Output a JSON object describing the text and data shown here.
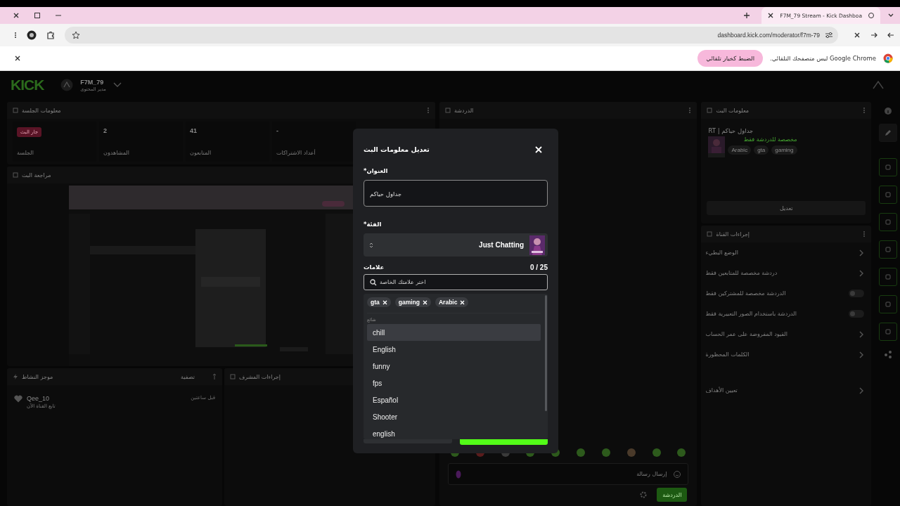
{
  "browser": {
    "tab": {
      "title": "F7M_79 Stream - Kick Dashboa",
      "selected": true
    },
    "address": "dashboard.kick.com/moderator/f7m-79",
    "infobar": {
      "message": "Google Chrome ليس متصفحك التلقائي.",
      "button": "الضبط كخيار تلقائي"
    }
  },
  "dashboard": {
    "header": {
      "logo": "KICK",
      "channel": "F7M_79",
      "role": "مدير المحتوى"
    },
    "session": {
      "title": "معلومات الجلسة",
      "stats": [
        {
          "kind": "number",
          "value": "-",
          "label": "أعداد الاشتراكات"
        },
        {
          "kind": "number",
          "value": "41",
          "label": "المتابعون"
        },
        {
          "kind": "number",
          "value": "2",
          "label": "المشاهدون"
        },
        {
          "kind": "badge",
          "value": "جار البث",
          "label": "الجلسة"
        }
      ]
    },
    "review": {
      "title": "مراجعة البث"
    },
    "activity": {
      "title": "موجز النشاط",
      "filter": "تصفية",
      "items": [
        {
          "user": "Qee_10",
          "action": "تابع القناة الآن",
          "time": "قبل ساعتين"
        }
      ]
    },
    "mod_actions": {
      "title": "إجراءات المشرف"
    },
    "chat": {
      "title": "الدردشة",
      "placeholder": "إرسال رسالة",
      "send": "الدردشة"
    },
    "stream_info": {
      "title": "معلومات البث",
      "stream_title": "جداول حياكم | RT",
      "category": "مخصصة للدردشة فقط",
      "tags": [
        "gaming",
        "gta",
        "Arabic"
      ],
      "edit": "تعديل"
    },
    "channel_actions": {
      "title": "إجراءات القناة",
      "items": [
        {
          "kind": "link",
          "label": "الوضع البطيء"
        },
        {
          "kind": "link",
          "label": "دردشة مخصصة للمتابعين فقط"
        },
        {
          "kind": "toggle",
          "label": "الدردشة مخصصة للمشتركين فقط",
          "on": false
        },
        {
          "kind": "toggle",
          "label": "الدردشة باستخدام الصور التعبيرية فقط",
          "on": false
        },
        {
          "kind": "link",
          "label": "القيود المفروضة على عمر الحساب"
        },
        {
          "kind": "link",
          "label": "الكلمات المحظورة"
        }
      ],
      "more_items": [
        {
          "kind": "link",
          "label": "تعيين الأهداف"
        }
      ]
    }
  },
  "modal": {
    "title": "تعديل معلومات البث",
    "title_label": "العنوان*",
    "title_value": "جداول حياكم",
    "category_label": "الفئة*",
    "category": "Just Chatting",
    "tags_label": "علامات",
    "tag_count": "0 / 25",
    "search_placeholder": "اختر علامتك الخاصة",
    "selected_tags": [
      "Arabic",
      "gaming",
      "gta"
    ],
    "suggestions_heading": "شائع",
    "suggestions": [
      {
        "label": "chill",
        "selected": true
      },
      {
        "label": "English",
        "selected": false
      },
      {
        "label": "funny",
        "selected": false
      },
      {
        "label": "fps",
        "selected": false
      },
      {
        "label": "Español",
        "selected": false
      },
      {
        "label": "Shooter",
        "selected": false
      },
      {
        "label": "english",
        "selected": false
      }
    ]
  }
}
